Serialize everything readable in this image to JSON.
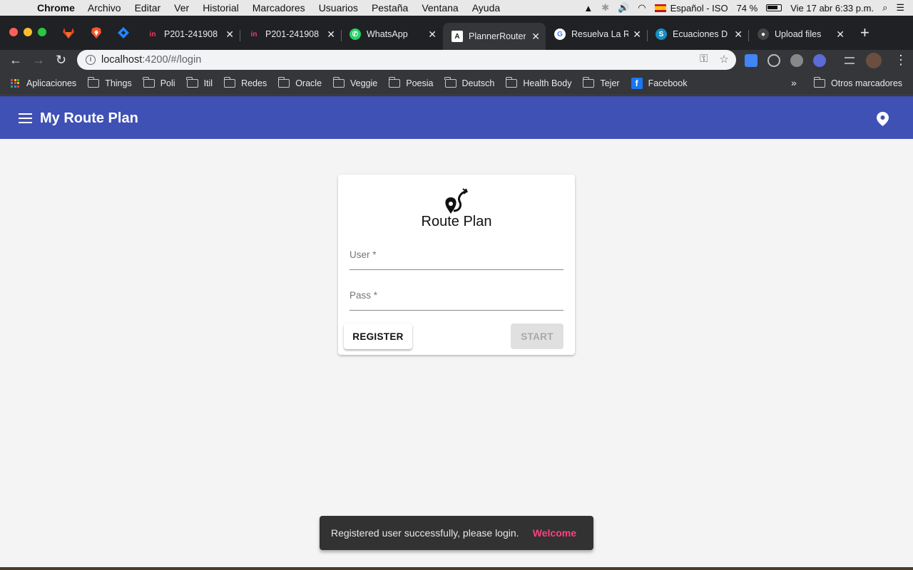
{
  "menubar": {
    "app": "Chrome",
    "items": [
      "Archivo",
      "Editar",
      "Ver",
      "Historial",
      "Marcadores",
      "Usuarios",
      "Pestaña",
      "Ventana",
      "Ayuda"
    ],
    "input_source": "Español - ISO",
    "battery": "74 %",
    "datetime": "Vie 17 abr  6:33 p.m."
  },
  "tabs": [
    {
      "title": "P201-241908",
      "icon": "invision-icon"
    },
    {
      "title": "P201-241908",
      "icon": "invision-icon"
    },
    {
      "title": "WhatsApp",
      "icon": "whatsapp-icon"
    },
    {
      "title": "PlannerRouter",
      "icon": "angular-icon"
    },
    {
      "title": "Resuelva La R",
      "icon": "google-icon"
    },
    {
      "title": "Ecuaciones D",
      "icon": "symbolab-icon"
    },
    {
      "title": "Upload files",
      "icon": "github-icon"
    }
  ],
  "address": {
    "host": "localhost",
    "path": ":4200/#/login"
  },
  "bookmarks": [
    "Aplicaciones",
    "Things",
    "Poli",
    "Itil",
    "Redes",
    "Oracle",
    "Veggie",
    "Poesia",
    "Deutsch",
    "Health Body",
    "Tejer",
    "Facebook"
  ],
  "bookmarks_other": "Otros marcadores",
  "app": {
    "title": "My Route Plan",
    "brand": "Route Plan",
    "user_label": "User *",
    "pass_label": "Pass *",
    "register_label": "REGISTER",
    "start_label": "START"
  },
  "snackbar": {
    "message": "Registered user successfully, please login.",
    "action": "Welcome"
  },
  "colors": {
    "primary": "#3f51b5",
    "accent": "#ff4081"
  }
}
